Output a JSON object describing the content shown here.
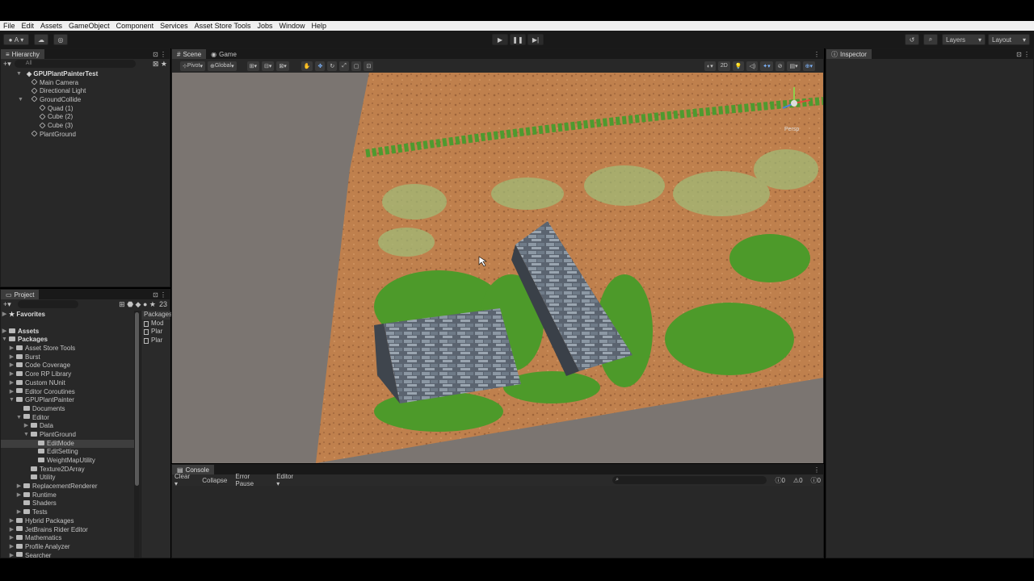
{
  "menu": [
    "File",
    "Edit",
    "Assets",
    "GameObject",
    "Component",
    "Services",
    "Asset Store Tools",
    "Jobs",
    "Window",
    "Help"
  ],
  "toolbar": {
    "account": "A",
    "layers": "Layers",
    "layout": "Layout"
  },
  "hierarchy": {
    "title": "Hierarchy",
    "search": "All",
    "scene": "GPUPlantPainterTest",
    "items": [
      {
        "label": "Main Camera",
        "indent": 1
      },
      {
        "label": "Directional Light",
        "indent": 1
      },
      {
        "label": "GroundCollide",
        "indent": 1,
        "expanded": true
      },
      {
        "label": "Quad (1)",
        "indent": 2
      },
      {
        "label": "Cube (2)",
        "indent": 2
      },
      {
        "label": "Cube (3)",
        "indent": 2
      },
      {
        "label": "PlantGround",
        "indent": 1
      }
    ]
  },
  "project": {
    "title": "Project",
    "count": "23",
    "favorites": "Favorites",
    "assets": "Assets",
    "packages": "Packages",
    "tree": [
      {
        "label": "Asset Store Tools",
        "indent": 1,
        "arrow": "right"
      },
      {
        "label": "Burst",
        "indent": 1,
        "arrow": "right"
      },
      {
        "label": "Code Coverage",
        "indent": 1,
        "arrow": "right"
      },
      {
        "label": "Core RP Library",
        "indent": 1,
        "arrow": "right"
      },
      {
        "label": "Custom NUnit",
        "indent": 1,
        "arrow": "right"
      },
      {
        "label": "Editor Coroutines",
        "indent": 1,
        "arrow": "right"
      },
      {
        "label": "GPUPlantPainter",
        "indent": 1,
        "arrow": "down"
      },
      {
        "label": "Documents",
        "indent": 2,
        "arrow": ""
      },
      {
        "label": "Editor",
        "indent": 2,
        "arrow": "down"
      },
      {
        "label": "Data",
        "indent": 3,
        "arrow": "right"
      },
      {
        "label": "PlantGround",
        "indent": 3,
        "arrow": "down"
      },
      {
        "label": "EditMode",
        "indent": 4,
        "arrow": "",
        "selected": true
      },
      {
        "label": "EditSetting",
        "indent": 4,
        "arrow": ""
      },
      {
        "label": "WeightMapUtility",
        "indent": 4,
        "arrow": ""
      },
      {
        "label": "Texture2DArray",
        "indent": 3,
        "arrow": ""
      },
      {
        "label": "Utility",
        "indent": 3,
        "arrow": ""
      },
      {
        "label": "ReplacementRenderer",
        "indent": 2,
        "arrow": "right"
      },
      {
        "label": "Runtime",
        "indent": 2,
        "arrow": "right"
      },
      {
        "label": "Shaders",
        "indent": 2,
        "arrow": ""
      },
      {
        "label": "Tests",
        "indent": 2,
        "arrow": "right"
      },
      {
        "label": "Hybrid Packages",
        "indent": 1,
        "arrow": "right"
      },
      {
        "label": "JetBrains Rider Editor",
        "indent": 1,
        "arrow": "right"
      },
      {
        "label": "Mathematics",
        "indent": 1,
        "arrow": "right"
      },
      {
        "label": "Profile Analyzer",
        "indent": 1,
        "arrow": "right"
      },
      {
        "label": "Searcher",
        "indent": 1,
        "arrow": "right"
      }
    ],
    "right_header": "Packages",
    "right_items": [
      "Mod",
      "Plar",
      "Plar"
    ]
  },
  "scene": {
    "tab_scene": "Scene",
    "tab_game": "Game",
    "pivot": "Pivot",
    "global": "Global",
    "mode2d": "2D",
    "persp": "Persp"
  },
  "inspector": {
    "title": "Inspector"
  },
  "console": {
    "title": "Console",
    "clear": "Clear",
    "collapse": "Collapse",
    "error_pause": "Error Pause",
    "editor": "Editor",
    "count_log": "0",
    "count_warn": "0",
    "count_err": "0"
  }
}
